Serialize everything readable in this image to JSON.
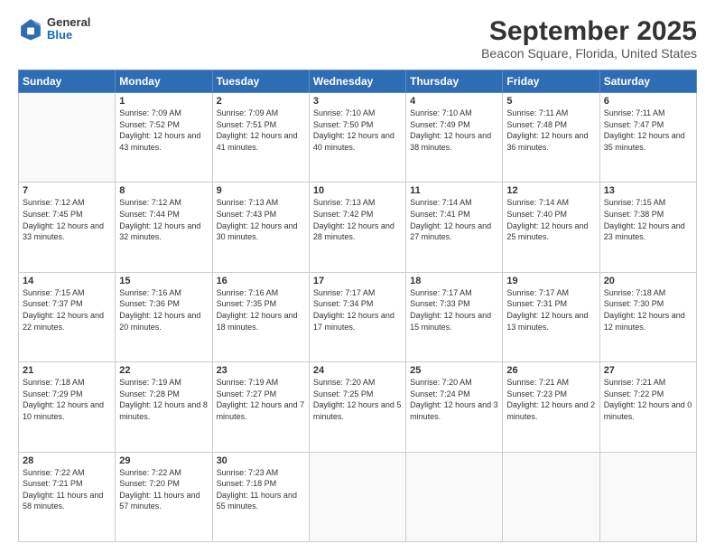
{
  "logo": {
    "general": "General",
    "blue": "Blue"
  },
  "title": "September 2025",
  "subtitle": "Beacon Square, Florida, United States",
  "weekdays": [
    "Sunday",
    "Monday",
    "Tuesday",
    "Wednesday",
    "Thursday",
    "Friday",
    "Saturday"
  ],
  "weeks": [
    [
      {
        "day": "",
        "sunrise": "",
        "sunset": "",
        "daylight": ""
      },
      {
        "day": "1",
        "sunrise": "Sunrise: 7:09 AM",
        "sunset": "Sunset: 7:52 PM",
        "daylight": "Daylight: 12 hours and 43 minutes."
      },
      {
        "day": "2",
        "sunrise": "Sunrise: 7:09 AM",
        "sunset": "Sunset: 7:51 PM",
        "daylight": "Daylight: 12 hours and 41 minutes."
      },
      {
        "day": "3",
        "sunrise": "Sunrise: 7:10 AM",
        "sunset": "Sunset: 7:50 PM",
        "daylight": "Daylight: 12 hours and 40 minutes."
      },
      {
        "day": "4",
        "sunrise": "Sunrise: 7:10 AM",
        "sunset": "Sunset: 7:49 PM",
        "daylight": "Daylight: 12 hours and 38 minutes."
      },
      {
        "day": "5",
        "sunrise": "Sunrise: 7:11 AM",
        "sunset": "Sunset: 7:48 PM",
        "daylight": "Daylight: 12 hours and 36 minutes."
      },
      {
        "day": "6",
        "sunrise": "Sunrise: 7:11 AM",
        "sunset": "Sunset: 7:47 PM",
        "daylight": "Daylight: 12 hours and 35 minutes."
      }
    ],
    [
      {
        "day": "7",
        "sunrise": "Sunrise: 7:12 AM",
        "sunset": "Sunset: 7:45 PM",
        "daylight": "Daylight: 12 hours and 33 minutes."
      },
      {
        "day": "8",
        "sunrise": "Sunrise: 7:12 AM",
        "sunset": "Sunset: 7:44 PM",
        "daylight": "Daylight: 12 hours and 32 minutes."
      },
      {
        "day": "9",
        "sunrise": "Sunrise: 7:13 AM",
        "sunset": "Sunset: 7:43 PM",
        "daylight": "Daylight: 12 hours and 30 minutes."
      },
      {
        "day": "10",
        "sunrise": "Sunrise: 7:13 AM",
        "sunset": "Sunset: 7:42 PM",
        "daylight": "Daylight: 12 hours and 28 minutes."
      },
      {
        "day": "11",
        "sunrise": "Sunrise: 7:14 AM",
        "sunset": "Sunset: 7:41 PM",
        "daylight": "Daylight: 12 hours and 27 minutes."
      },
      {
        "day": "12",
        "sunrise": "Sunrise: 7:14 AM",
        "sunset": "Sunset: 7:40 PM",
        "daylight": "Daylight: 12 hours and 25 minutes."
      },
      {
        "day": "13",
        "sunrise": "Sunrise: 7:15 AM",
        "sunset": "Sunset: 7:38 PM",
        "daylight": "Daylight: 12 hours and 23 minutes."
      }
    ],
    [
      {
        "day": "14",
        "sunrise": "Sunrise: 7:15 AM",
        "sunset": "Sunset: 7:37 PM",
        "daylight": "Daylight: 12 hours and 22 minutes."
      },
      {
        "day": "15",
        "sunrise": "Sunrise: 7:16 AM",
        "sunset": "Sunset: 7:36 PM",
        "daylight": "Daylight: 12 hours and 20 minutes."
      },
      {
        "day": "16",
        "sunrise": "Sunrise: 7:16 AM",
        "sunset": "Sunset: 7:35 PM",
        "daylight": "Daylight: 12 hours and 18 minutes."
      },
      {
        "day": "17",
        "sunrise": "Sunrise: 7:17 AM",
        "sunset": "Sunset: 7:34 PM",
        "daylight": "Daylight: 12 hours and 17 minutes."
      },
      {
        "day": "18",
        "sunrise": "Sunrise: 7:17 AM",
        "sunset": "Sunset: 7:33 PM",
        "daylight": "Daylight: 12 hours and 15 minutes."
      },
      {
        "day": "19",
        "sunrise": "Sunrise: 7:17 AM",
        "sunset": "Sunset: 7:31 PM",
        "daylight": "Daylight: 12 hours and 13 minutes."
      },
      {
        "day": "20",
        "sunrise": "Sunrise: 7:18 AM",
        "sunset": "Sunset: 7:30 PM",
        "daylight": "Daylight: 12 hours and 12 minutes."
      }
    ],
    [
      {
        "day": "21",
        "sunrise": "Sunrise: 7:18 AM",
        "sunset": "Sunset: 7:29 PM",
        "daylight": "Daylight: 12 hours and 10 minutes."
      },
      {
        "day": "22",
        "sunrise": "Sunrise: 7:19 AM",
        "sunset": "Sunset: 7:28 PM",
        "daylight": "Daylight: 12 hours and 8 minutes."
      },
      {
        "day": "23",
        "sunrise": "Sunrise: 7:19 AM",
        "sunset": "Sunset: 7:27 PM",
        "daylight": "Daylight: 12 hours and 7 minutes."
      },
      {
        "day": "24",
        "sunrise": "Sunrise: 7:20 AM",
        "sunset": "Sunset: 7:25 PM",
        "daylight": "Daylight: 12 hours and 5 minutes."
      },
      {
        "day": "25",
        "sunrise": "Sunrise: 7:20 AM",
        "sunset": "Sunset: 7:24 PM",
        "daylight": "Daylight: 12 hours and 3 minutes."
      },
      {
        "day": "26",
        "sunrise": "Sunrise: 7:21 AM",
        "sunset": "Sunset: 7:23 PM",
        "daylight": "Daylight: 12 hours and 2 minutes."
      },
      {
        "day": "27",
        "sunrise": "Sunrise: 7:21 AM",
        "sunset": "Sunset: 7:22 PM",
        "daylight": "Daylight: 12 hours and 0 minutes."
      }
    ],
    [
      {
        "day": "28",
        "sunrise": "Sunrise: 7:22 AM",
        "sunset": "Sunset: 7:21 PM",
        "daylight": "Daylight: 11 hours and 58 minutes."
      },
      {
        "day": "29",
        "sunrise": "Sunrise: 7:22 AM",
        "sunset": "Sunset: 7:20 PM",
        "daylight": "Daylight: 11 hours and 57 minutes."
      },
      {
        "day": "30",
        "sunrise": "Sunrise: 7:23 AM",
        "sunset": "Sunset: 7:18 PM",
        "daylight": "Daylight: 11 hours and 55 minutes."
      },
      {
        "day": "",
        "sunrise": "",
        "sunset": "",
        "daylight": ""
      },
      {
        "day": "",
        "sunrise": "",
        "sunset": "",
        "daylight": ""
      },
      {
        "day": "",
        "sunrise": "",
        "sunset": "",
        "daylight": ""
      },
      {
        "day": "",
        "sunrise": "",
        "sunset": "",
        "daylight": ""
      }
    ]
  ]
}
